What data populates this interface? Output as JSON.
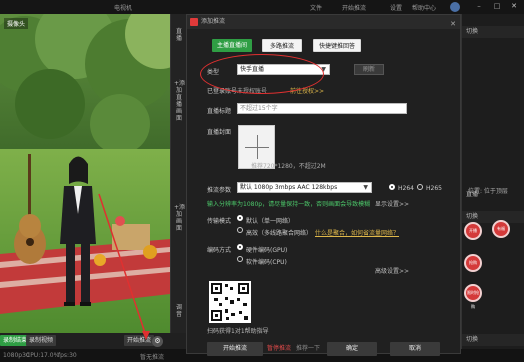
{
  "topbar": {
    "app_name": "电视机",
    "menus": [
      "文件",
      "开始推流",
      "设置",
      "帮助中心"
    ],
    "window_controls": {
      "minimize": "–",
      "maximize": "□",
      "close": "✕"
    }
  },
  "preview": {
    "sidebar_labels": [
      "直播",
      "+添加直播画面",
      "+添加画面"
    ],
    "bottom_buttons": {
      "record_end": "录制结束",
      "record_video": "录制视频",
      "start_stream": "开始推流"
    },
    "side_label_bottom": "调音",
    "overlay_label": "摄像头"
  },
  "statusbar": {
    "resolution": "1080p30",
    "cpu": "CPU:17.0%",
    "fps": "fps:30",
    "stopped": "暂无推流"
  },
  "dialog": {
    "title": "添加推流",
    "close_icon": "✕",
    "tabs": [
      {
        "label": "主播直播间",
        "active": true
      },
      {
        "label": "多路推流",
        "active": false
      },
      {
        "label": "快捷键推回答",
        "active": false
      }
    ],
    "type": {
      "label": "类型",
      "value": "快手直播",
      "refresh": "刷新"
    },
    "account": {
      "label": "已登录账号",
      "value": "未授权账号",
      "link": "前往授权>>"
    },
    "title_field": {
      "label": "直播标题",
      "placeholder": "不超过15个字"
    },
    "cover": {
      "label": "直播封面",
      "hint1": "推荐720*1280，不超过2M"
    },
    "params": {
      "label": "推流参数",
      "value": "默认 1080p 3mbps AAC 128kbps",
      "h264": "H264",
      "h265": "H265"
    },
    "note": "输入分辨率为1080p，请尽量保持一致，否则画面会导致模糊",
    "show_settings": "显示设置>>",
    "transfer": {
      "label": "传输模式",
      "opt1": "默认（单一网络）",
      "opt2": "高效（多线路聚合网络）",
      "opt2_link": "什么是聚合，如何省流量网络？"
    },
    "encode": {
      "label": "编码方式",
      "opt1": "硬件编码(GPU)",
      "opt2": "软件编码(CPU)"
    },
    "advanced": "高级设置>>",
    "qr_caption": "扫码获得1对1帮助指导",
    "footer": {
      "start": "开始推流",
      "stop": "暂停推流",
      "help": "推荐一下",
      "ok": "确定",
      "cancel": "取消"
    }
  },
  "right_panel": {
    "header1": "切换",
    "header2": "直播",
    "tool_label": "切换",
    "position_label": "位置: 位于顶层",
    "sticker_labels": [
      "开播",
      "有福",
      "抢购",
      "限时抢购"
    ],
    "bottom_label": "切换"
  },
  "annotation_color": "#e03030",
  "accent_green": "#2f9e44"
}
